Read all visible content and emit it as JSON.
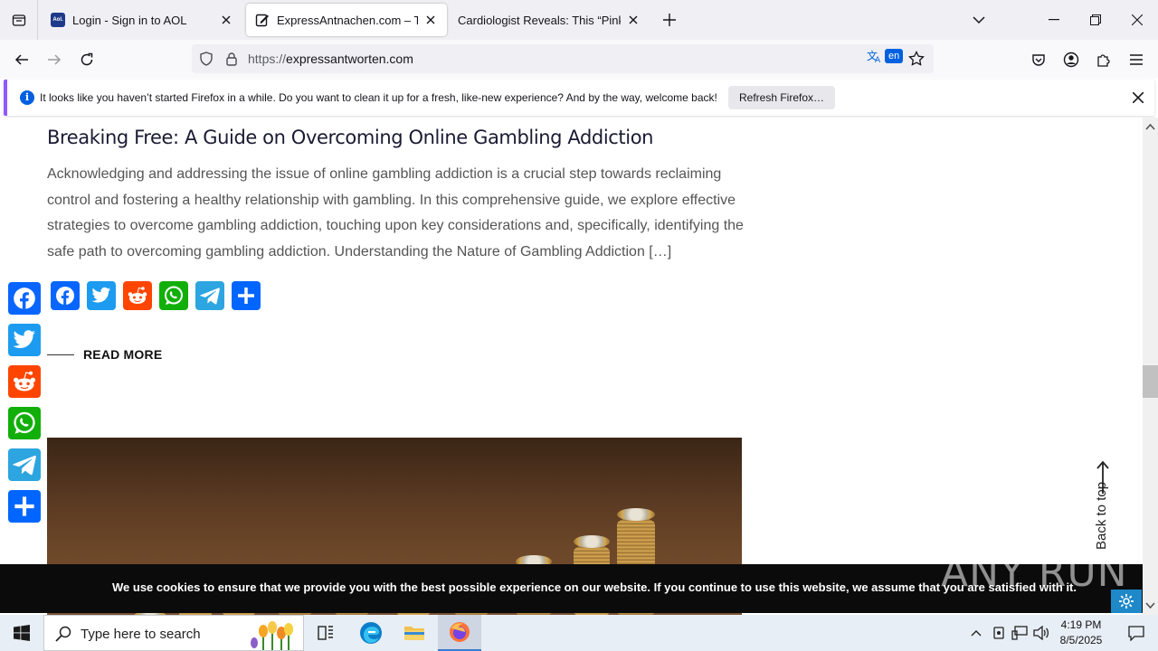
{
  "browser": {
    "tabs": [
      {
        "title": "Login - Sign in to AOL",
        "favicon": "aol-logo-icon",
        "active": false
      },
      {
        "title": "ExpressAntnachen.com – The m",
        "favicon": "edit-document-icon",
        "active": true
      },
      {
        "title": "Cardiologist Reveals: This “Pink Salt",
        "favicon": "none",
        "active": false
      }
    ],
    "url_protocol": "https://",
    "url_host": "expressantworten.com",
    "translate_lang": "en"
  },
  "notification": {
    "message": "It looks like you haven’t started Firefox in a while. Do you want to clean it up for a fresh, like-new experience? And by the way, welcome back!",
    "button_label": "Refresh Firefox…",
    "accent": "#9059ff"
  },
  "article": {
    "title": "Breaking Free: A Guide on Overcoming Online Gambling Addiction",
    "excerpt": "Acknowledging and addressing the issue of online gambling addiction is a crucial step towards reclaiming control and fostering a healthy relationship with gambling. In this comprehensive guide, we explore effective strategies to overcome gambling addiction, touching upon key considerations and, specifically, identifying the safe path to overcoming gambling addiction. Understanding the Nature of Gambling Addiction […]",
    "read_more": "READ MORE",
    "share_services": [
      {
        "name": "Facebook",
        "icon": "facebook-icon",
        "color": "#0866ff"
      },
      {
        "name": "Twitter",
        "icon": "twitter-icon",
        "color": "#1d9bf0"
      },
      {
        "name": "Reddit",
        "icon": "reddit-icon",
        "color": "#ff4500"
      },
      {
        "name": "WhatsApp",
        "icon": "whatsapp-icon",
        "color": "#12af0a"
      },
      {
        "name": "Telegram",
        "icon": "telegram-icon",
        "color": "#2ca5e0"
      },
      {
        "name": "Share",
        "icon": "share-plus-icon",
        "color": "#0166ff"
      }
    ]
  },
  "back_to_top": "Back to top",
  "cookie_banner": {
    "text": "We use cookies to ensure that we provide you with the best possible experience on our website. If you continue to use this website, we assume that you are satisfied with it."
  },
  "watermark": "ANY RUN",
  "taskbar": {
    "search_placeholder": "Type here to search",
    "time": "4:19 PM",
    "date": "8/5/2025"
  }
}
